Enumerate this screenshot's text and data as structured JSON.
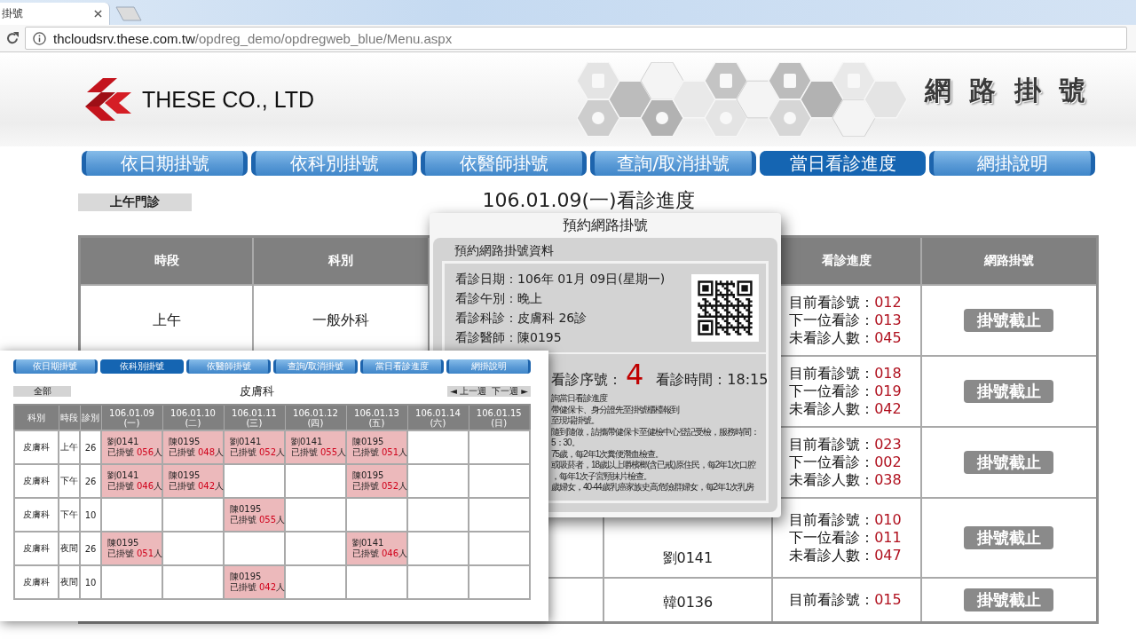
{
  "browser": {
    "tab_title": "掛號",
    "url_host": "thcloudsrv.these.com.tw",
    "url_path": "/opdreg_demo/opdregweb_blue/Menu.aspx"
  },
  "header": {
    "company": "THESE CO., LTD",
    "site_title": "網 路 掛 號"
  },
  "nav": [
    {
      "label": "依日期掛號",
      "selected": false
    },
    {
      "label": "依科別掛號",
      "selected": false
    },
    {
      "label": "依醫師掛號",
      "selected": false
    },
    {
      "label": "查詢/取消掛號",
      "selected": false
    },
    {
      "label": "當日看診進度",
      "selected": true
    },
    {
      "label": "網掛說明",
      "selected": false
    }
  ],
  "progress": {
    "session": "上午門診",
    "title": "106.01.09(一)看診進度",
    "columns": [
      "時段",
      "科別",
      "看診進度",
      "網路掛號"
    ],
    "rows": [
      {
        "period": "上午",
        "department": "一般外科",
        "status": [
          {
            "label": "目前看診號：",
            "value": "012"
          },
          {
            "label": "下一位看診：",
            "value": "013"
          },
          {
            "label": "未看診人數：",
            "value": "045"
          }
        ],
        "action": {
          "label": "掛號截止",
          "disabled": true
        }
      },
      {
        "status": [
          {
            "label": "目前看診號：",
            "value": "018"
          },
          {
            "label": "下一位看診：",
            "value": "019"
          },
          {
            "label": "未看診人數：",
            "value": "042"
          }
        ],
        "action": {
          "label": "掛號截止",
          "disabled": true
        }
      },
      {
        "status": [
          {
            "label": "目前看診號：",
            "value": "023"
          },
          {
            "label": "下一位看診：",
            "value": "002"
          },
          {
            "label": "未看診人數：",
            "value": "038"
          }
        ],
        "action": {
          "label": "掛號截止",
          "disabled": true
        }
      },
      {
        "doctor": "劉0141",
        "status": [
          {
            "label": "目前看診號：",
            "value": "010"
          },
          {
            "label": "下一位看診：",
            "value": "011"
          },
          {
            "label": "未看診人數：",
            "value": "047"
          }
        ],
        "action": {
          "label": "掛號截止",
          "disabled": true
        }
      },
      {
        "doctor": "韓0136",
        "status": [
          {
            "label": "目前看診號：",
            "value": "015"
          }
        ],
        "action": {
          "label": "掛號截止",
          "disabled": true
        }
      }
    ]
  },
  "dialog": {
    "title": "預約網路掛號",
    "section": "預約網路掛號資料",
    "fields": [
      "看診日期：106年 01月 09日(星期一)",
      "看診午別：晚上",
      "看診科診：皮膚科 26診",
      "看診醫師：陳0195"
    ],
    "sequence_label": "看診序號：",
    "sequence": "4",
    "time": "看診時間：18:15",
    "notes": [
      "詢當日看診進度",
      "帶健保卡、身分證先至掛號櫃檯報到",
      "至現場掛號。",
      "隨到隨做，請攜帶健保卡至健檢中心登記受檢，服務時間：",
      "5：30。",
      "75歲，每2年1次糞便潛血檢查。",
      "或吸菸者，18歲以上嚼檳榔(含已戒)原住民，每2年1次口腔",
      "，每年1次子宮頸抹片檢查。",
      "歲婦女，40-44歲乳癌家族史高危險群婦女，每2年1次乳房"
    ]
  },
  "inset": {
    "nav": [
      {
        "label": "依日期掛號",
        "selected": false
      },
      {
        "label": "依科別掛號",
        "selected": true
      },
      {
        "label": "依醫師掛號",
        "selected": false
      },
      {
        "label": "查詢/取消掛號",
        "selected": false
      },
      {
        "label": "當日看診進度",
        "selected": false
      },
      {
        "label": "網掛說明",
        "selected": false
      }
    ],
    "filter": "全部",
    "department": "皮膚科",
    "week_prev": "◄ 上一週",
    "week_next": "下一週 ►",
    "columns": [
      "科別",
      "時段",
      "診別"
    ],
    "dates": [
      {
        "date": "106.01.09",
        "weekday": "(一)"
      },
      {
        "date": "106.01.10",
        "weekday": "(二)"
      },
      {
        "date": "106.01.11",
        "weekday": "(三)"
      },
      {
        "date": "106.01.12",
        "weekday": "(四)"
      },
      {
        "date": "106.01.13",
        "weekday": "(五)"
      },
      {
        "date": "106.01.14",
        "weekday": "(六)"
      },
      {
        "date": "106.01.15",
        "weekday": "(日)"
      }
    ],
    "rows": [
      {
        "department": "皮膚科",
        "period": "上午",
        "room": "26",
        "slots": [
          {
            "booked": true,
            "doctor": "劉0141",
            "label": "已掛號",
            "count": "056",
            "unit": "人"
          },
          {
            "booked": true,
            "doctor": "陳0195",
            "label": "已掛號",
            "count": "048",
            "unit": "人"
          },
          {
            "booked": true,
            "doctor": "劉0141",
            "label": "已掛號",
            "count": "052",
            "unit": "人"
          },
          {
            "booked": true,
            "doctor": "劉0141",
            "label": "已掛號",
            "count": "055",
            "unit": "人"
          },
          {
            "booked": true,
            "doctor": "陳0195",
            "label": "已掛號",
            "count": "051",
            "unit": "人"
          },
          {
            "booked": false
          },
          {
            "booked": false
          }
        ]
      },
      {
        "department": "皮膚科",
        "period": "下午",
        "room": "26",
        "slots": [
          {
            "booked": true,
            "doctor": "劉0141",
            "label": "已掛號",
            "count": "046",
            "unit": "人"
          },
          {
            "booked": true,
            "doctor": "陳0195",
            "label": "已掛號",
            "count": "042",
            "unit": "人"
          },
          {
            "booked": false
          },
          {
            "booked": false
          },
          {
            "booked": true,
            "doctor": "陳0195",
            "label": "已掛號",
            "count": "052",
            "unit": "人"
          },
          {
            "booked": false
          },
          {
            "booked": false
          }
        ]
      },
      {
        "department": "皮膚科",
        "period": "下午",
        "room": "10",
        "slots": [
          {
            "booked": false
          },
          {
            "booked": false
          },
          {
            "booked": true,
            "doctor": "陳0195",
            "label": "已掛號",
            "count": "055",
            "unit": "人"
          },
          {
            "booked": false
          },
          {
            "booked": false
          },
          {
            "booked": false
          },
          {
            "booked": false
          }
        ]
      },
      {
        "department": "皮膚科",
        "period": "夜間",
        "room": "26",
        "slots": [
          {
            "booked": true,
            "doctor": "陳0195",
            "label": "已掛號",
            "count": "051",
            "unit": "人"
          },
          {
            "booked": false
          },
          {
            "booked": false
          },
          {
            "booked": false
          },
          {
            "booked": true,
            "doctor": "劉0141",
            "label": "已掛號",
            "count": "046",
            "unit": "人"
          },
          {
            "booked": false
          },
          {
            "booked": false
          }
        ]
      },
      {
        "department": "皮膚科",
        "period": "夜間",
        "room": "10",
        "slots": [
          {
            "booked": false
          },
          {
            "booked": false
          },
          {
            "booked": true,
            "doctor": "陳0195",
            "label": "已掛號",
            "count": "042",
            "unit": "人"
          },
          {
            "booked": false
          },
          {
            "booked": false
          },
          {
            "booked": false
          },
          {
            "booked": false
          }
        ]
      }
    ]
  }
}
